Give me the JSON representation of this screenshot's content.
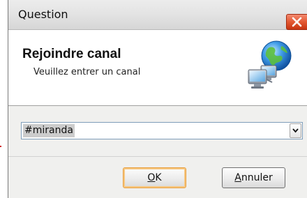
{
  "window": {
    "title": "Question"
  },
  "header": {
    "title": "Rejoindre canal",
    "subtitle": "Veuillez entrer un canal",
    "icon": "network-globe-icon"
  },
  "channel_combo": {
    "value": "#miranda"
  },
  "buttons": {
    "ok_label": "K",
    "ok_mnemonic": "O",
    "cancel_label": "nnuler",
    "cancel_mnemonic": "A"
  },
  "colors": {
    "close_button": "#e35832",
    "default_button_border": "#e8a040",
    "selection": "#cccccc"
  }
}
